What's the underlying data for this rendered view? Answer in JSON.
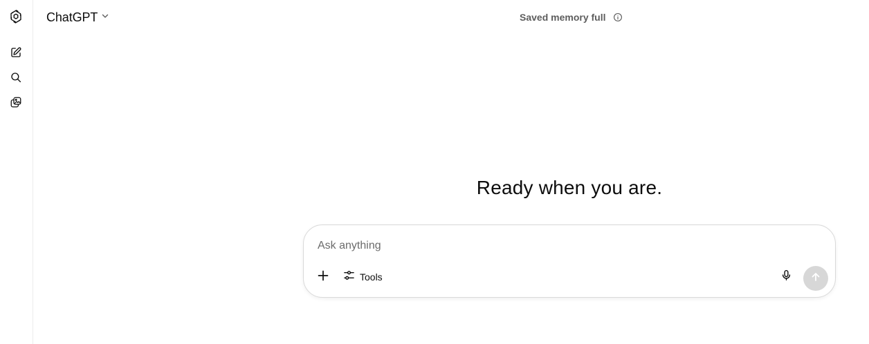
{
  "header": {
    "model_name": "ChatGPT",
    "memory_status": "Saved memory full"
  },
  "sidebar": {
    "items": [
      {
        "icon": "openai-logo-icon"
      },
      {
        "icon": "new-chat-icon"
      },
      {
        "icon": "search-icon"
      },
      {
        "icon": "library-icon"
      }
    ]
  },
  "main": {
    "headline": "Ready when you are."
  },
  "composer": {
    "placeholder": "Ask anything",
    "value": "",
    "tools_label": "Tools",
    "icons": {
      "attach": "plus-icon",
      "tools": "sliders-icon",
      "voice": "microphone-icon",
      "send": "arrow-up-icon"
    }
  },
  "colors": {
    "text": "#0d0d0d",
    "muted": "#5d5d5d",
    "border": "#d9d9d9",
    "send_disabled": "#d7d7d7"
  }
}
